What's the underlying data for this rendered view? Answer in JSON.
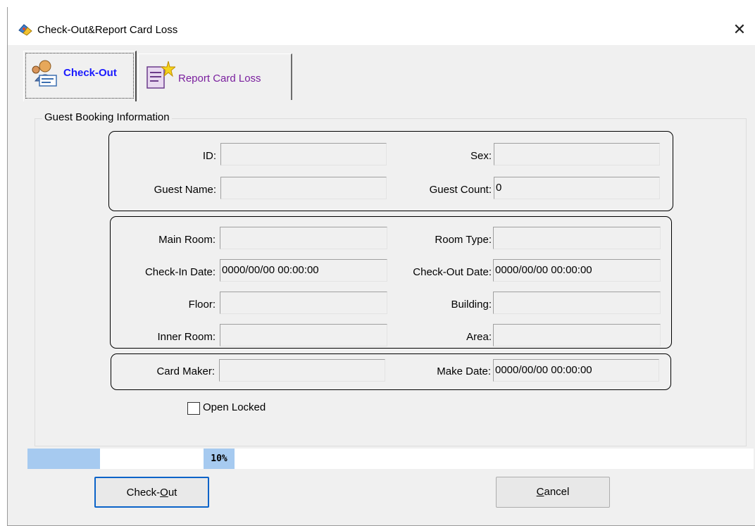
{
  "window": {
    "title": "Check-Out&Report Card Loss",
    "close_glyph": "✕"
  },
  "tabs": [
    {
      "label": "Check-Out",
      "icon": "guest-card-icon",
      "active": true
    },
    {
      "label": "Report Card Loss",
      "icon": "report-loss-icon",
      "active": false
    }
  ],
  "group": {
    "title": "Guest Booking Information"
  },
  "guest": {
    "id_label": "ID:",
    "id_value": "",
    "sex_label": "Sex:",
    "sex_value": "",
    "name_label": "Guest Name:",
    "name_value": "",
    "count_label": "Guest Count:",
    "count_value": "0"
  },
  "room": {
    "main_label": "Main Room:",
    "main_value": "",
    "type_label": "Room Type:",
    "type_value": "",
    "checkin_label": "Check-In Date:",
    "checkin_value": "0000/00/00 00:00:00",
    "checkout_label": "Check-Out Date:",
    "checkout_value": "0000/00/00 00:00:00",
    "floor_label": "Floor:",
    "floor_value": "",
    "building_label": "Building:",
    "building_value": "",
    "inner_label": "Inner Room:",
    "inner_value": "",
    "area_label": "Area:",
    "area_value": ""
  },
  "card": {
    "maker_label": "Card Maker:",
    "maker_value": "",
    "date_label": "Make Date:",
    "date_value": "0000/00/00 00:00:00"
  },
  "open_locked": {
    "label": "Open Locked",
    "checked": false
  },
  "progress": {
    "percent": 10,
    "text": "10%"
  },
  "buttons": {
    "checkout_pre": "Check-",
    "checkout_mnemonic": "O",
    "checkout_post": "ut",
    "cancel_mnemonic": "C",
    "cancel_post": "ancel"
  },
  "colors": {
    "progress_fill": "#a6caf0",
    "tab_active": "#1a1aff",
    "tab_inactive": "#7a1f9e",
    "default_button_border": "#0b63c8"
  }
}
